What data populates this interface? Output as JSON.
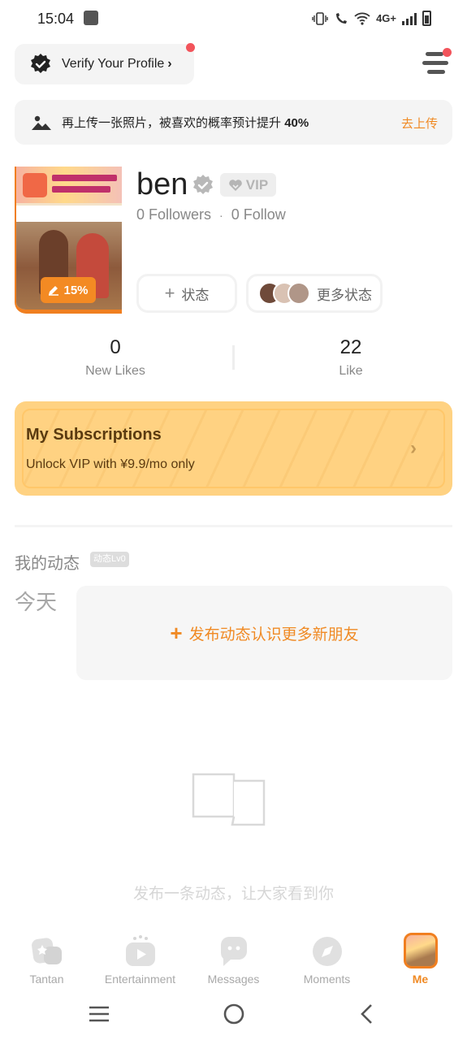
{
  "status_bar": {
    "time": "15:04",
    "network": "4G+"
  },
  "header": {
    "verify_label": "Verify Your Profile",
    "verify_chevron": "›",
    "menu_icon": "menu-lines-icon",
    "notification_dot_color": "#f2545b"
  },
  "upload_banner": {
    "text": "再上传一张照片，被喜欢的概率预计提升",
    "percent": "40%",
    "action": "去上传",
    "accent_color": "#f08a24"
  },
  "profile": {
    "name": "ben",
    "vip_label": "VIP",
    "followers": "0 Followers",
    "separator": "·",
    "follow": "0 Follow",
    "profile_completion": "15%",
    "status_button": "状态",
    "more_status_button": "更多状态"
  },
  "counts": {
    "new_likes_value": "0",
    "new_likes_label": "New Likes",
    "like_value": "22",
    "like_label": "Like"
  },
  "subscriptions": {
    "title": "My Subscriptions",
    "subtitle": "Unlock VIP with ¥9.9/mo only",
    "chevron": "›",
    "card_color": "#ffd282"
  },
  "moments": {
    "title": "我的动态",
    "level": "动态Lv0",
    "today": "今天",
    "post_prompt": "发布动态认识更多新朋友",
    "empty_text": "发布一条动态，让大家看到你"
  },
  "bottom_nav": {
    "items": [
      {
        "label": "Tantan",
        "icon": "tantan-icon"
      },
      {
        "label": "Entertainment",
        "icon": "play-tv-icon"
      },
      {
        "label": "Messages",
        "icon": "chat-bubble-icon"
      },
      {
        "label": "Moments",
        "icon": "compass-icon"
      },
      {
        "label": "Me",
        "icon": "profile-avatar-icon",
        "active": true
      }
    ],
    "active_color": "#f08a24"
  }
}
